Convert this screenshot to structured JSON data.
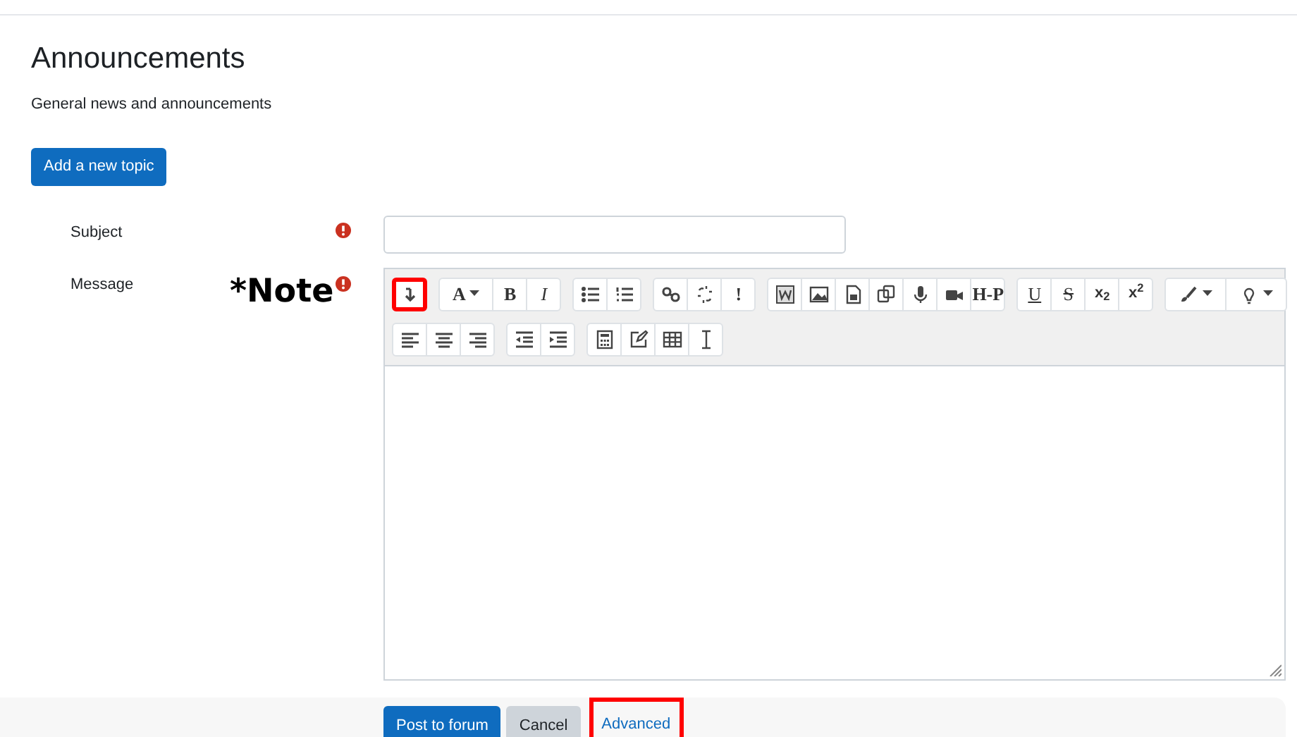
{
  "title": "Announcements",
  "description": "General news and announcements",
  "add_button": "Add a new topic",
  "fields": [
    {
      "label": "Subject",
      "required": true,
      "kind": "input"
    },
    {
      "label": "Message",
      "required": true,
      "kind": "editor"
    }
  ],
  "note": "*Note",
  "toolbar": [
    [
      [
        {
          "kind": "icon",
          "highlighted": true
        }
      ],
      [
        {
          "kind": "text",
          "label": "A",
          "dropdown": true
        },
        {
          "kind": "text",
          "label": "B"
        },
        {
          "kind": "text",
          "label": "I"
        }
      ],
      [
        {
          "kind": "icon"
        },
        {
          "kind": "icon"
        }
      ],
      [
        {
          "kind": "icon"
        },
        {
          "kind": "icon"
        },
        {
          "kind": "text",
          "label": "!"
        }
      ],
      [
        {
          "kind": "icon"
        },
        {
          "kind": "icon"
        },
        {
          "kind": "icon"
        },
        {
          "kind": "icon"
        },
        {
          "kind": "icon"
        },
        {
          "kind": "icon"
        },
        {
          "kind": "text",
          "label": "H-P"
        }
      ],
      [
        {
          "kind": "text",
          "label": "U"
        },
        {
          "kind": "text",
          "label": "S"
        },
        {
          "kind": "text",
          "label": "x$_{2}$"
        },
        {
          "kind": "text",
          "label": "x$^{2}$"
        }
      ],
      [
        {
          "kind": "icon",
          "dropdown": true
        },
        {
          "kind": "icon",
          "dropdown": true
        }
      ]
    ],
    [
      [
        {
          "kind": "icon"
        },
        {
          "kind": "icon"
        },
        {
          "kind": "icon"
        }
      ],
      [
        {
          "kind": "icon"
        },
        {
          "kind": "icon"
        }
      ],
      [
        {
          "kind": "icon"
        },
        {
          "kind": "icon"
        },
        {
          "kind": "icon"
        },
        {
          "kind": "icon"
        }
      ]
    ]
  ],
  "actions": [
    {
      "label": "Post to forum",
      "kind": "primary"
    },
    {
      "label": "Cancel",
      "kind": "secondary"
    },
    {
      "label": "Advanced",
      "kind": "link",
      "highlighted": true
    }
  ]
}
